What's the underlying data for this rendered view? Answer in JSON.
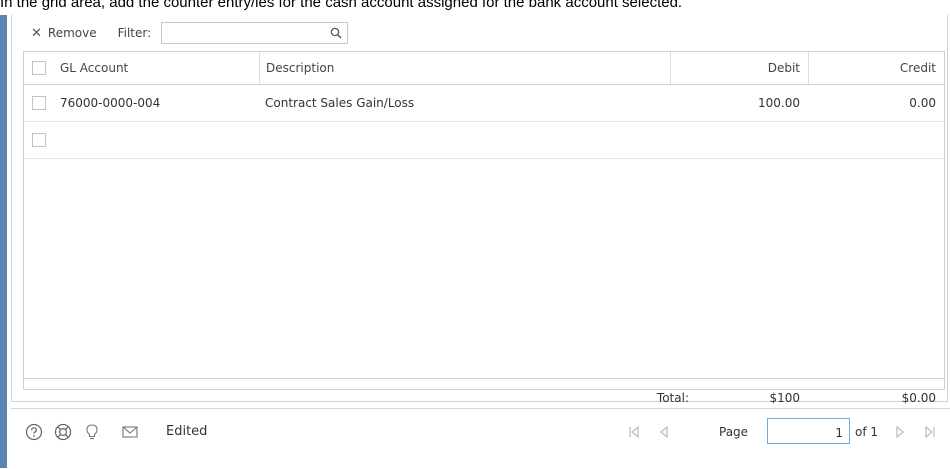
{
  "caption": "In the grid area, add the counter entry/ies for the cash account assigned for the bank account selected.",
  "toolbar": {
    "remove_label": "Remove",
    "filter_label": "Filter:",
    "filter_value": "",
    "filter_placeholder": ""
  },
  "grid": {
    "columns": {
      "gl_account": "GL Account",
      "description": "Description",
      "debit": "Debit",
      "credit": "Credit"
    },
    "rows": [
      {
        "gl_account": "76000-0000-004",
        "description": "Contract Sales Gain/Loss",
        "debit": "100.00",
        "credit": "0.00"
      },
      {
        "gl_account": "",
        "description": "",
        "debit": "",
        "credit": ""
      }
    ],
    "totals": {
      "label": "Total:",
      "debit": "$100",
      "credit": "$0.00"
    }
  },
  "footer": {
    "status": "Edited",
    "icons": [
      "help-icon",
      "support-icon",
      "lightbulb-icon",
      "mail-icon"
    ],
    "pager": {
      "page_label": "Page",
      "page_value": "1",
      "of_label": "of 1"
    }
  },
  "colors": {
    "accent_bar": "#5a85b2",
    "input_focus_border": "#7aa7d9"
  }
}
